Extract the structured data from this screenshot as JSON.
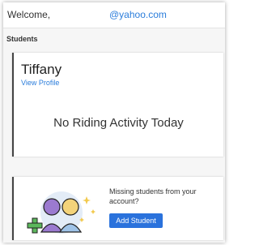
{
  "header": {
    "welcome": "Welcome,",
    "email_suffix": "@yahoo.com"
  },
  "section": {
    "label": "Students"
  },
  "student_card": {
    "name": "Tiffany",
    "view_profile": "View Profile",
    "activity_status": "No Riding Activity Today"
  },
  "missing_card": {
    "message": "Missing students from your account?",
    "button": "Add Student",
    "illustration": "students-add-illustration"
  },
  "colors": {
    "link": "#2b7ddb",
    "button": "#2a72dc",
    "plus": "#5cb85c"
  }
}
